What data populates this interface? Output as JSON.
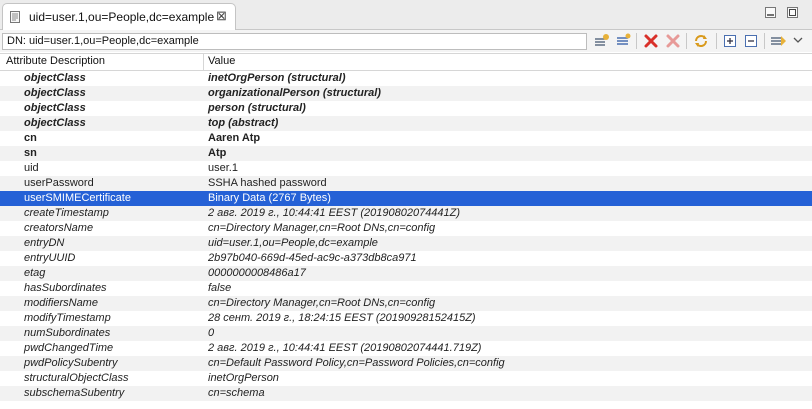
{
  "tab": {
    "title": "uid=user.1,ou=People,dc=example",
    "close": "⊠"
  },
  "dn_bar": {
    "text": "DN: uid=user.1,ou=People,dc=example"
  },
  "table": {
    "headers": [
      "Attribute Description",
      "Value"
    ],
    "rows": [
      {
        "attr": "objectClass",
        "value": "inetOrgPerson (structural)",
        "style": "bi"
      },
      {
        "attr": "objectClass",
        "value": "organizationalPerson (structural)",
        "style": "bi"
      },
      {
        "attr": "objectClass",
        "value": "person (structural)",
        "style": "bi"
      },
      {
        "attr": "objectClass",
        "value": "top (abstract)",
        "style": "bi"
      },
      {
        "attr": "cn",
        "value": "Aaren Atp",
        "style": "b"
      },
      {
        "attr": "sn",
        "value": "Atp",
        "style": "b"
      },
      {
        "attr": "uid",
        "value": "user.1",
        "style": ""
      },
      {
        "attr": "userPassword",
        "value": "SSHA hashed password",
        "style": ""
      },
      {
        "attr": "userSMIMECertificate",
        "value": "Binary Data (2767 Bytes)",
        "style": "",
        "selected": true
      },
      {
        "attr": "createTimestamp",
        "value": "2 авг. 2019 г., 10:44:41 EEST (20190802074441Z)",
        "style": "i"
      },
      {
        "attr": "creatorsName",
        "value": "cn=Directory Manager,cn=Root DNs,cn=config",
        "style": "i"
      },
      {
        "attr": "entryDN",
        "value": "uid=user.1,ou=People,dc=example",
        "style": "i"
      },
      {
        "attr": "entryUUID",
        "value": "2b97b040-669d-45ed-ac9c-a373db8ca971",
        "style": "i"
      },
      {
        "attr": "etag",
        "value": "0000000008486a17",
        "style": "i"
      },
      {
        "attr": "hasSubordinates",
        "value": "false",
        "style": "i"
      },
      {
        "attr": "modifiersName",
        "value": "cn=Directory Manager,cn=Root DNs,cn=config",
        "style": "i"
      },
      {
        "attr": "modifyTimestamp",
        "value": "28 сент. 2019 г., 18:24:15 EEST (20190928152415Z)",
        "style": "i"
      },
      {
        "attr": "numSubordinates",
        "value": "0",
        "style": "i"
      },
      {
        "attr": "pwdChangedTime",
        "value": "2 авг. 2019 г., 10:44:41 EEST (20190802074441.719Z)",
        "style": "i"
      },
      {
        "attr": "pwdPolicySubentry",
        "value": "cn=Default Password Policy,cn=Password Policies,cn=config",
        "style": "i"
      },
      {
        "attr": "structuralObjectClass",
        "value": "inetOrgPerson",
        "style": "i"
      },
      {
        "attr": "subschemaSubentry",
        "value": "cn=schema",
        "style": "i"
      }
    ]
  },
  "colors": {
    "selection": "#2561d6",
    "alt_row": "#f2f2f2",
    "delete_red": "#d9302a"
  },
  "icons": [
    "entry-icon",
    "close-icon",
    "minimize-icon",
    "maximize-icon",
    "new-attribute-icon",
    "new-value-icon",
    "delete-icon",
    "delete-all-icon",
    "refresh-icon",
    "expand-all-icon",
    "collapse-all-icon",
    "view-menu-icon",
    "dropdown-icon"
  ]
}
